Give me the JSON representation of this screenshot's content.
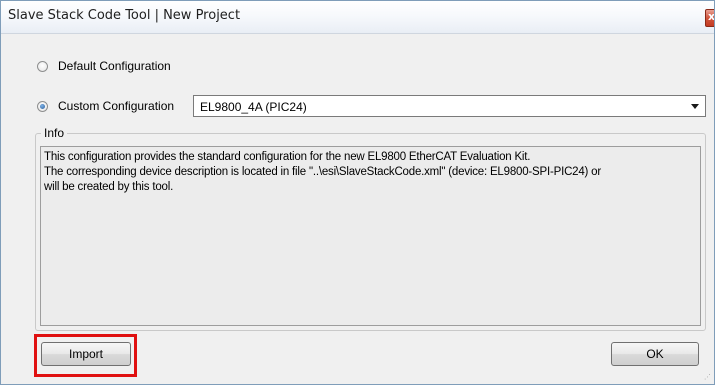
{
  "window": {
    "title": "Slave Stack Code Tool | New Project",
    "close_glyph": "x"
  },
  "config": {
    "default_label": "Default Configuration",
    "custom_label": "Custom Configuration",
    "selected": "custom",
    "combo_value": "EL9800_4A (PIC24)"
  },
  "info": {
    "legend": "Info",
    "lines": [
      "This configuration provides the standard configuration for the new EL9800 EtherCAT Evaluation Kit.",
      "The corresponding device description is located in file \"..\\esi\\SlaveStackCode.xml\" (device: EL9800-SPI-PIC24) or",
      "will be created by this tool."
    ]
  },
  "buttons": {
    "import_label": "Import",
    "ok_label": "OK"
  },
  "colors": {
    "highlight": "#e01010",
    "close_button": "#c43b22",
    "radio_dot": "#2a5d9c"
  },
  "icons": {
    "close": "close-icon",
    "dropdown": "chevron-down-icon",
    "resize": "resize-grip-icon"
  }
}
